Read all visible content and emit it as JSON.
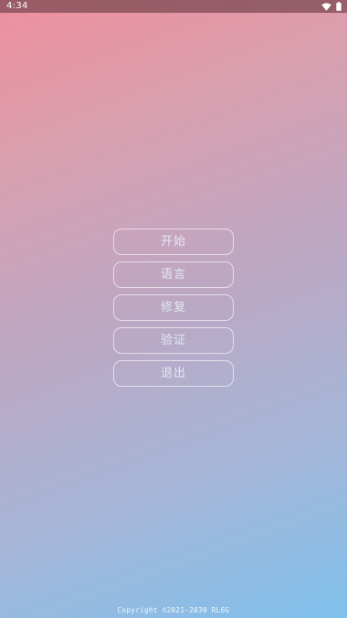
{
  "status_bar": {
    "time": "4:34",
    "icons": [
      "wifi-icon",
      "battery-icon"
    ]
  },
  "menu": {
    "items": [
      {
        "label": "开始"
      },
      {
        "label": "语言"
      },
      {
        "label": "修复"
      },
      {
        "label": "验证"
      },
      {
        "label": "退出"
      }
    ]
  },
  "footer": {
    "copyright": "Copyright ©2021-2030 RL6G"
  },
  "colors": {
    "gradient_top": "#ef8f9d",
    "gradient_bottom": "#7fc0ec",
    "button_border": "#ffffff",
    "button_text": "#ebf6ff"
  }
}
